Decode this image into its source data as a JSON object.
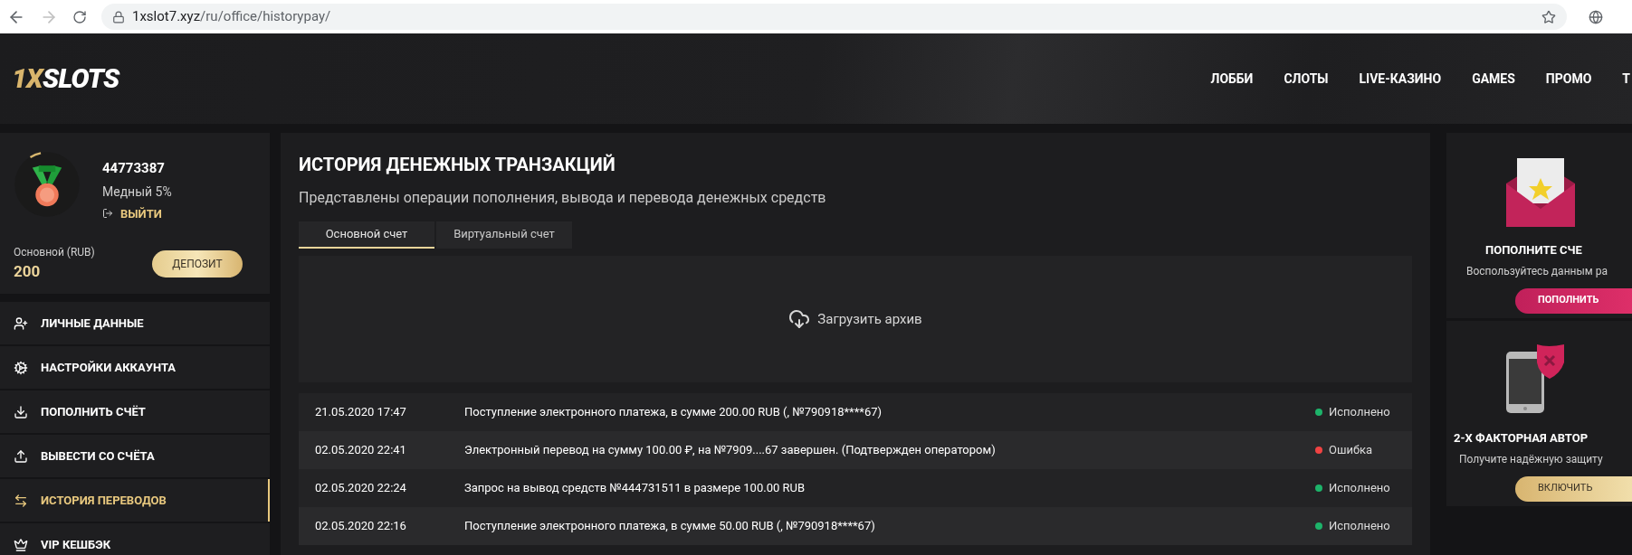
{
  "browser": {
    "url_host": "1xslot7.xyz",
    "url_path": "/ru/office/historypay/"
  },
  "header": {
    "logo": {
      "accent": "1X",
      "text": "SLOTS"
    },
    "nav": [
      "ЛОББИ",
      "СЛОТЫ",
      "LIVE-КАЗИНО",
      "GAMES",
      "ПРОМО",
      "Т"
    ]
  },
  "profile": {
    "id": "44773387",
    "level": "Медный 5%",
    "logout": "ВЫЙТИ",
    "balance_label": "Основной (RUB)",
    "balance": "200",
    "deposit": "ДЕПОЗИТ"
  },
  "sidebar": {
    "items": [
      {
        "label": "ЛИЧНЫЕ ДАННЫЕ",
        "kind": "user",
        "selected": false
      },
      {
        "label": "НАСТРОЙКИ АККАУНТА",
        "kind": "settings",
        "selected": false
      },
      {
        "label": "ПОПОЛНИТЬ СЧЁТ",
        "kind": "download",
        "selected": false
      },
      {
        "label": "ВЫВЕСТИ СО СЧЁТА",
        "kind": "upload",
        "selected": false
      },
      {
        "label": "ИСТОРИЯ ПЕРЕВОДОВ",
        "kind": "transfer",
        "selected": true
      },
      {
        "label": "VIP КЕШБЭК",
        "kind": "crown",
        "selected": false
      }
    ]
  },
  "main": {
    "title": "ИСТОРИЯ ДЕНЕЖНЫХ ТРАНЗАКЦИЙ",
    "subtitle": "Представлены операции пополнения, вывода и перевода денежных средств",
    "tabs": [
      {
        "label": "Основной счет",
        "selected": true
      },
      {
        "label": "Виртуальный счет",
        "selected": false
      }
    ],
    "download": "Загрузить архив",
    "rows": [
      {
        "date": "21.05.2020 17:47",
        "description": "Поступление электронного платежа, в сумме 200.00 RUB (, №790918****67)",
        "status": "Исполнено",
        "color": "#1db36a"
      },
      {
        "date": "02.05.2020 22:41",
        "description": "Электронный перевод на сумму 100.00 ₽, на №7909....67 завершен. (Подтвержден оператором)",
        "status": "Ошибка",
        "color": "#f04343"
      },
      {
        "date": "02.05.2020 22:24",
        "description": "Запрос на вывод средств №444731511 в размере 100.00 RUB",
        "status": "Исполнено",
        "color": "#1db36a"
      },
      {
        "date": "02.05.2020 22:16",
        "description": "Поступление электронного платежа, в сумме 50.00 RUB (, №790918****67)",
        "status": "Исполнено",
        "color": "#1db36a"
      }
    ]
  },
  "promos": [
    {
      "kind": "envelope",
      "title": "ПОПОЛНИТЕ СЧЕ",
      "text": "Воспользуйтесь данным ра",
      "button": "ПОПОЛНИТЬ"
    },
    {
      "kind": "phone",
      "title": "2-Х ФАКТОРНАЯ АВТОР",
      "text": "Получите надёжную защиту",
      "button": "ВКЛЮЧИТЬ"
    }
  ]
}
